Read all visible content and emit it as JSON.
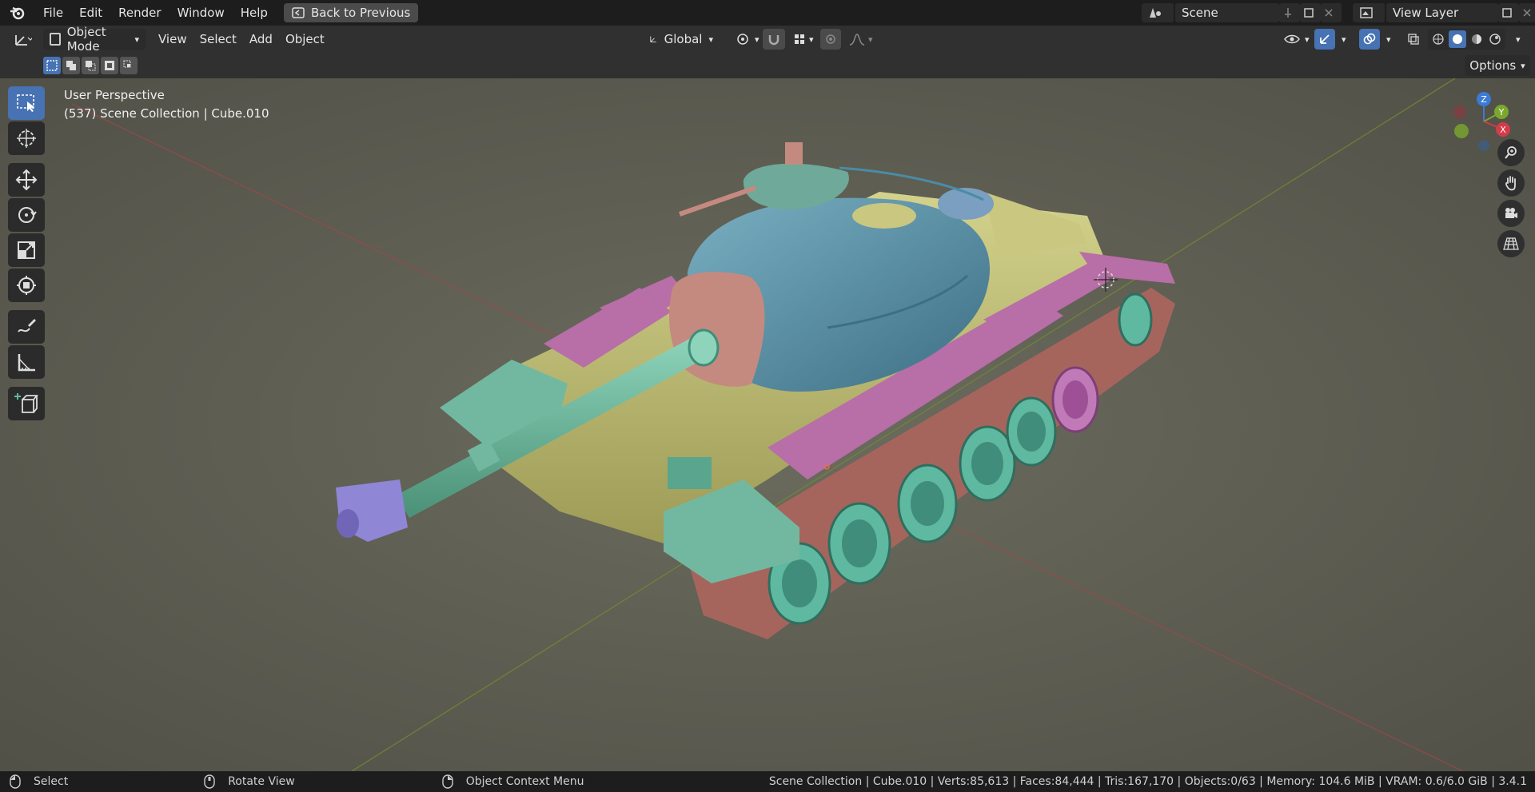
{
  "menu": {
    "items": [
      "File",
      "Edit",
      "Render",
      "Window",
      "Help"
    ],
    "back_button": "Back to Previous"
  },
  "scene": {
    "label": "Scene",
    "view_layer": "View Layer"
  },
  "header": {
    "mode": "Object Mode",
    "menus": [
      "View",
      "Select",
      "Add",
      "Object"
    ],
    "orientation": "Global",
    "options": "Options"
  },
  "viewport": {
    "perspective": "User Perspective",
    "collection": "(537) Scene Collection | Cube.010",
    "gizmo": {
      "z": "Z",
      "y": "Y",
      "x": "X"
    }
  },
  "status": {
    "left_select": "Select",
    "middle_rotate": "Rotate View",
    "right_context": "Object Context Menu",
    "stats": "Scene Collection | Cube.010 | Verts:85,613 | Faces:84,444 | Tris:167,170 | Objects:0/63 | Memory: 104.6 MiB | VRAM: 0.6/6.0 GiB | 3.4.1"
  },
  "colors": {
    "accent": "#4772b3",
    "viewport_bg": "#3d3d3d",
    "turret": "#5a8fa6",
    "hull": "#c6c47a",
    "skirt": "#b86ea6",
    "wheels": "#5fb8a0",
    "barrel": "#72b8a0",
    "track": "#b8726a"
  }
}
